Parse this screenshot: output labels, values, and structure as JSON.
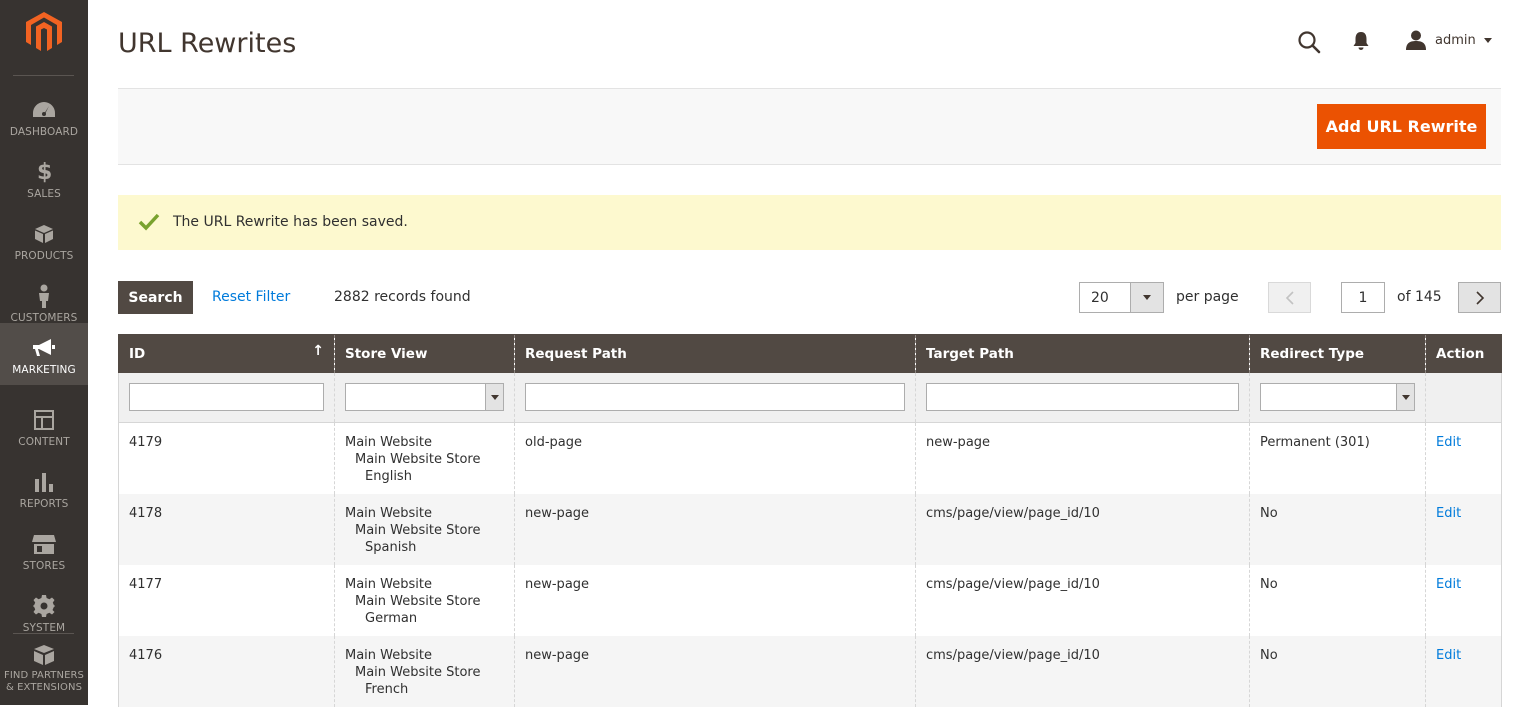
{
  "sidebar": {
    "items": [
      {
        "label": "DASHBOARD",
        "icon": "dashboard-icon"
      },
      {
        "label": "SALES",
        "icon": "dollar-icon"
      },
      {
        "label": "PRODUCTS",
        "icon": "box-icon"
      },
      {
        "label": "CUSTOMERS",
        "icon": "person-icon"
      },
      {
        "label": "MARKETING",
        "icon": "megaphone-icon"
      },
      {
        "label": "CONTENT",
        "icon": "layout-icon"
      },
      {
        "label": "REPORTS",
        "icon": "bar-chart-icon"
      },
      {
        "label": "STORES",
        "icon": "store-icon"
      },
      {
        "label": "SYSTEM",
        "icon": "gear-icon"
      }
    ],
    "partners_line1": "FIND PARTNERS",
    "partners_line2": "& EXTENSIONS",
    "active": "MARKETING"
  },
  "header": {
    "title": "URL Rewrites",
    "user": "admin"
  },
  "actions": {
    "add_label": "Add URL Rewrite"
  },
  "message": {
    "text": "The URL Rewrite has been saved."
  },
  "toolbar": {
    "search_label": "Search",
    "reset_label": "Reset Filter",
    "records": "2882 records found",
    "per_page_value": "20",
    "per_page_label": "per page",
    "page_value": "1",
    "page_of": "of 145"
  },
  "grid": {
    "columns": [
      "ID",
      "Store View",
      "Request Path",
      "Target Path",
      "Redirect Type",
      "Action"
    ],
    "sort_indicator": "↑",
    "rows": [
      {
        "id": "4179",
        "store_1": "Main Website",
        "store_2": "Main Website Store",
        "store_3": "English",
        "request_path": "old-page",
        "target_path": "new-page",
        "redirect_type": "Permanent (301)",
        "action": "Edit"
      },
      {
        "id": "4178",
        "store_1": "Main Website",
        "store_2": "Main Website Store",
        "store_3": "Spanish",
        "request_path": "new-page",
        "target_path": "cms/page/view/page_id/10",
        "redirect_type": "No",
        "action": "Edit"
      },
      {
        "id": "4177",
        "store_1": "Main Website",
        "store_2": "Main Website Store",
        "store_3": "German",
        "request_path": "new-page",
        "target_path": "cms/page/view/page_id/10",
        "redirect_type": "No",
        "action": "Edit"
      },
      {
        "id": "4176",
        "store_1": "Main Website",
        "store_2": "Main Website Store",
        "store_3": "French",
        "request_path": "new-page",
        "target_path": "cms/page/view/page_id/10",
        "redirect_type": "No",
        "action": "Edit"
      }
    ]
  },
  "colors": {
    "sidebar_bg": "#373330",
    "accent": "#eb5202",
    "header_row": "#514943",
    "link": "#007bdb",
    "success_bg": "#fdf9cf"
  }
}
